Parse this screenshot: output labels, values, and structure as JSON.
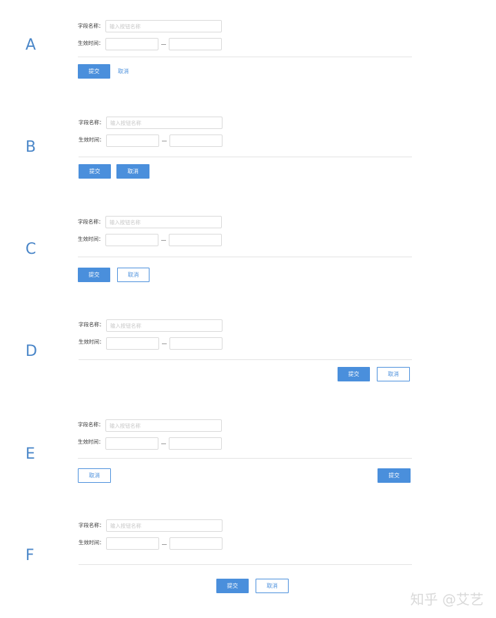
{
  "form": {
    "field_name_label": "字段名称：",
    "field_name_placeholder": "输入按钮名称",
    "effective_time_label": "生效时间：",
    "range_separator": "—"
  },
  "variants": [
    {
      "letter": "A",
      "submit_label": "提交",
      "cancel_label": "取消",
      "cancel_style": "text-link",
      "button_alignment": "left"
    },
    {
      "letter": "B",
      "submit_label": "提交",
      "cancel_label": "取消",
      "cancel_style": "filled",
      "button_alignment": "left"
    },
    {
      "letter": "C",
      "submit_label": "提交",
      "cancel_label": "取消",
      "cancel_style": "outlined",
      "button_alignment": "left"
    },
    {
      "letter": "D",
      "submit_label": "提交",
      "cancel_label": "取消",
      "cancel_style": "outlined",
      "button_alignment": "right"
    },
    {
      "letter": "E",
      "submit_label": "提交",
      "cancel_label": "取消",
      "cancel_style": "outlined",
      "button_alignment": "split (cancel left, submit right)"
    },
    {
      "letter": "F",
      "submit_label": "提交",
      "cancel_label": "取消",
      "cancel_style": "outlined",
      "button_alignment": "center"
    }
  ],
  "watermark": "知乎 @艾艺",
  "colors": {
    "primary": "#4a8fdc",
    "letter": "#4a86c8",
    "border": "#d9d9d9",
    "divider": "#e3e3e3"
  }
}
